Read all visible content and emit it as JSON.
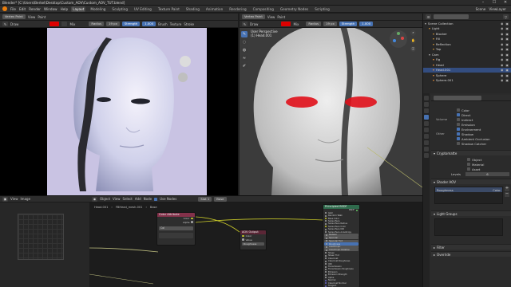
{
  "window": {
    "title": "Blender* [C:\\Users\\Berkel\\Desktop\\Custom_AOV\\Custom_AOV_TUT.blend]",
    "min": "–",
    "max": "☐",
    "close": "✕"
  },
  "menu": {
    "items": [
      "File",
      "Edit",
      "Render",
      "Window",
      "Help"
    ],
    "workspaces": [
      "Layout",
      "Modeling",
      "Sculpting",
      "UV Editing",
      "Texture Paint",
      "Shading",
      "Animation",
      "Rendering",
      "Compositing",
      "Geometry Nodes",
      "Scripting"
    ],
    "active_workspace": "Layout",
    "scene_label": "Scene",
    "view_layer_label": "ViewLayer"
  },
  "left_viewport": {
    "mode": "Vertex Paint",
    "menus": [
      "View",
      "Paint"
    ],
    "brush": "Draw",
    "blend": "Mix",
    "radius_label": "Radius",
    "radius_value": "19 px",
    "strength_label": "Strength",
    "strength_value": "1.000",
    "extra_menus": [
      "Brush",
      "Texture",
      "Stroke"
    ],
    "background_color": "#c9c3e3"
  },
  "right_viewport": {
    "mode": "Vertex Paint",
    "menus": [
      "View",
      "Paint"
    ],
    "brush": "Draw",
    "blend": "Mix",
    "radius_label": "Radius",
    "radius_value": "19 px",
    "strength_label": "Strength",
    "strength_value": "1.000",
    "overlay_lines": [
      "User Perspective",
      "(1) Head.001"
    ],
    "paint_color": "#e0101a"
  },
  "outliner": {
    "title": "Scene Collection",
    "rows": [
      {
        "label": "Scene Collection",
        "indent": 0,
        "selected": false
      },
      {
        "label": "Light",
        "indent": 1,
        "selected": false
      },
      {
        "label": "Blocker",
        "indent": 2,
        "selected": false
      },
      {
        "label": "Fill",
        "indent": 2,
        "selected": false
      },
      {
        "label": "Reflection",
        "indent": 2,
        "selected": false
      },
      {
        "label": "Top",
        "indent": 2,
        "selected": false
      },
      {
        "label": "Cam",
        "indent": 1,
        "selected": false
      },
      {
        "label": "Fig",
        "indent": 2,
        "selected": false
      },
      {
        "label": "Head",
        "indent": 2,
        "selected": false
      },
      {
        "label": "Head.001",
        "indent": 2,
        "selected": true
      },
      {
        "label": "Sphere",
        "indent": 2,
        "selected": false
      },
      {
        "label": "Sphere.001",
        "indent": 2,
        "selected": false
      }
    ]
  },
  "properties": {
    "checks_top": [
      {
        "label": "Color",
        "checked": false
      },
      {
        "label": "Direct",
        "checked": true
      },
      {
        "label": "Indirect",
        "checked": false
      },
      {
        "label": "Emission",
        "checked": false
      },
      {
        "label": "Environment",
        "checked": true
      },
      {
        "label": "Shadow",
        "checked": true
      },
      {
        "label": "Ambient Occlusion",
        "checked": true
      },
      {
        "label": "Shadow Catcher",
        "checked": false
      }
    ],
    "group_labels": [
      "Volume",
      "Other"
    ],
    "cryptomatte_title": "Cryptomatte",
    "crypto_checks": [
      {
        "label": "Object",
        "checked": false
      },
      {
        "label": "Material",
        "checked": false
      },
      {
        "label": "Asset",
        "checked": false
      }
    ],
    "levels_label": "Levels",
    "levels_value": "6",
    "shader_aov_title": "Shader AOV",
    "aov_name": "Roughness",
    "aov_type": "Color",
    "light_groups_title": "Light Groups",
    "filter_title": "Filter",
    "override_title": "Override"
  },
  "node_editor": {
    "header": [
      "Object",
      "View",
      "Select",
      "Add",
      "Node"
    ],
    "use_nodes_label": "Use Nodes",
    "slot_label": "Slot 1",
    "material_label": "Base",
    "left_header": [
      "View",
      "Image"
    ],
    "left_image": "Head.001",
    "breadcrumb": [
      "Head.001",
      "FBHead_mesh.001",
      "Base"
    ],
    "nodes": {
      "color_attribute": {
        "title": "Color Attribute",
        "outputs": [
          "Color",
          "Alpha"
        ],
        "field": "Col"
      },
      "aov_output": {
        "title": "AOV Output",
        "inputs": [
          "Color",
          "Value"
        ],
        "name": "Roughness"
      },
      "principled": {
        "title": "Principled BSDF",
        "rows": [
          "BSDF",
          "GGX",
          "Random Walk",
          "Base Color",
          "Subsurface",
          "Subsurface Radius",
          "Subsurface Color",
          "Subsurface IOR",
          "Subsurface Anisotropy",
          "Metallic",
          "Specular",
          "Specular Tint",
          "Roughness",
          "Anisotropic",
          "Anisotropic Rotation",
          "Sheen",
          "Sheen Tint",
          "Clearcoat",
          "Clearcoat Roughness",
          "IOR",
          "Transmission",
          "Transmission Roughness",
          "Emission",
          "Emission Strength",
          "Alpha",
          "Normal",
          "Clearcoat Normal",
          "Tangent"
        ]
      }
    }
  }
}
